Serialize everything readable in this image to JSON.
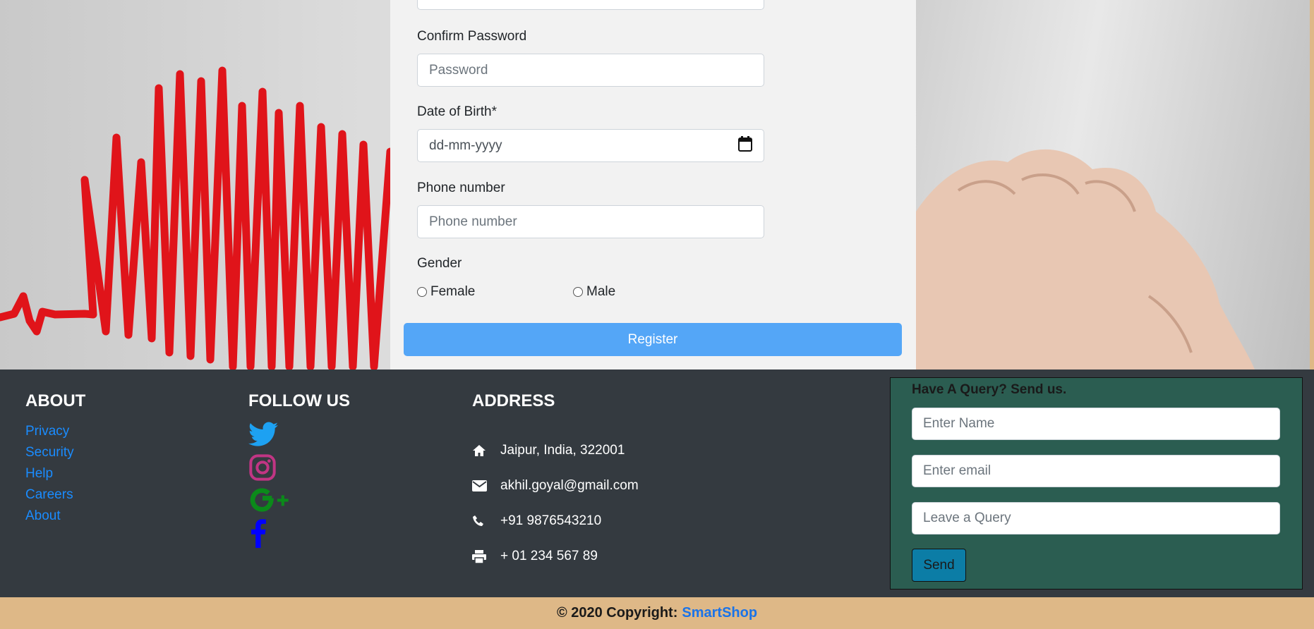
{
  "form": {
    "confirm_password_label": "Confirm Password",
    "confirm_password_placeholder": "Password",
    "dob_label": "Date of Birth*",
    "dob_placeholder": "dd-mm-yyyy",
    "phone_label": "Phone number",
    "phone_placeholder": "Phone number",
    "gender_label": "Gender",
    "gender_options": [
      "Female",
      "Male"
    ],
    "register_label": "Register"
  },
  "footer": {
    "about": {
      "title": "ABOUT",
      "links": [
        "Privacy",
        "Security",
        "Help",
        "Careers",
        "About"
      ]
    },
    "follow": {
      "title": "FOLLOW US",
      "icons": [
        "twitter-icon",
        "instagram-icon",
        "google-plus-icon",
        "facebook-icon"
      ]
    },
    "address": {
      "title": "ADDRESS",
      "items": [
        {
          "icon": "home-icon",
          "text": "Jaipur, India, 322001"
        },
        {
          "icon": "envelope-icon",
          "text": "akhil.goyal@gmail.com"
        },
        {
          "icon": "phone-icon",
          "text": "+91 9876543210"
        },
        {
          "icon": "print-icon",
          "text": "+ 01 234 567 89"
        }
      ]
    },
    "query": {
      "title": "Have A Query? Send us.",
      "name_placeholder": "Enter Name",
      "email_placeholder": "Enter email",
      "query_placeholder": "Leave a Query",
      "send_label": "Send"
    }
  },
  "copyright": {
    "prefix": "© 2020 Copyright:",
    "brand": "SmartShop"
  },
  "colors": {
    "register_button": "#54a6f7",
    "footer_bg": "#343a40",
    "query_bg": "#2b5d51",
    "link": "#1a8cff",
    "copyright_bg": "#deb887"
  }
}
